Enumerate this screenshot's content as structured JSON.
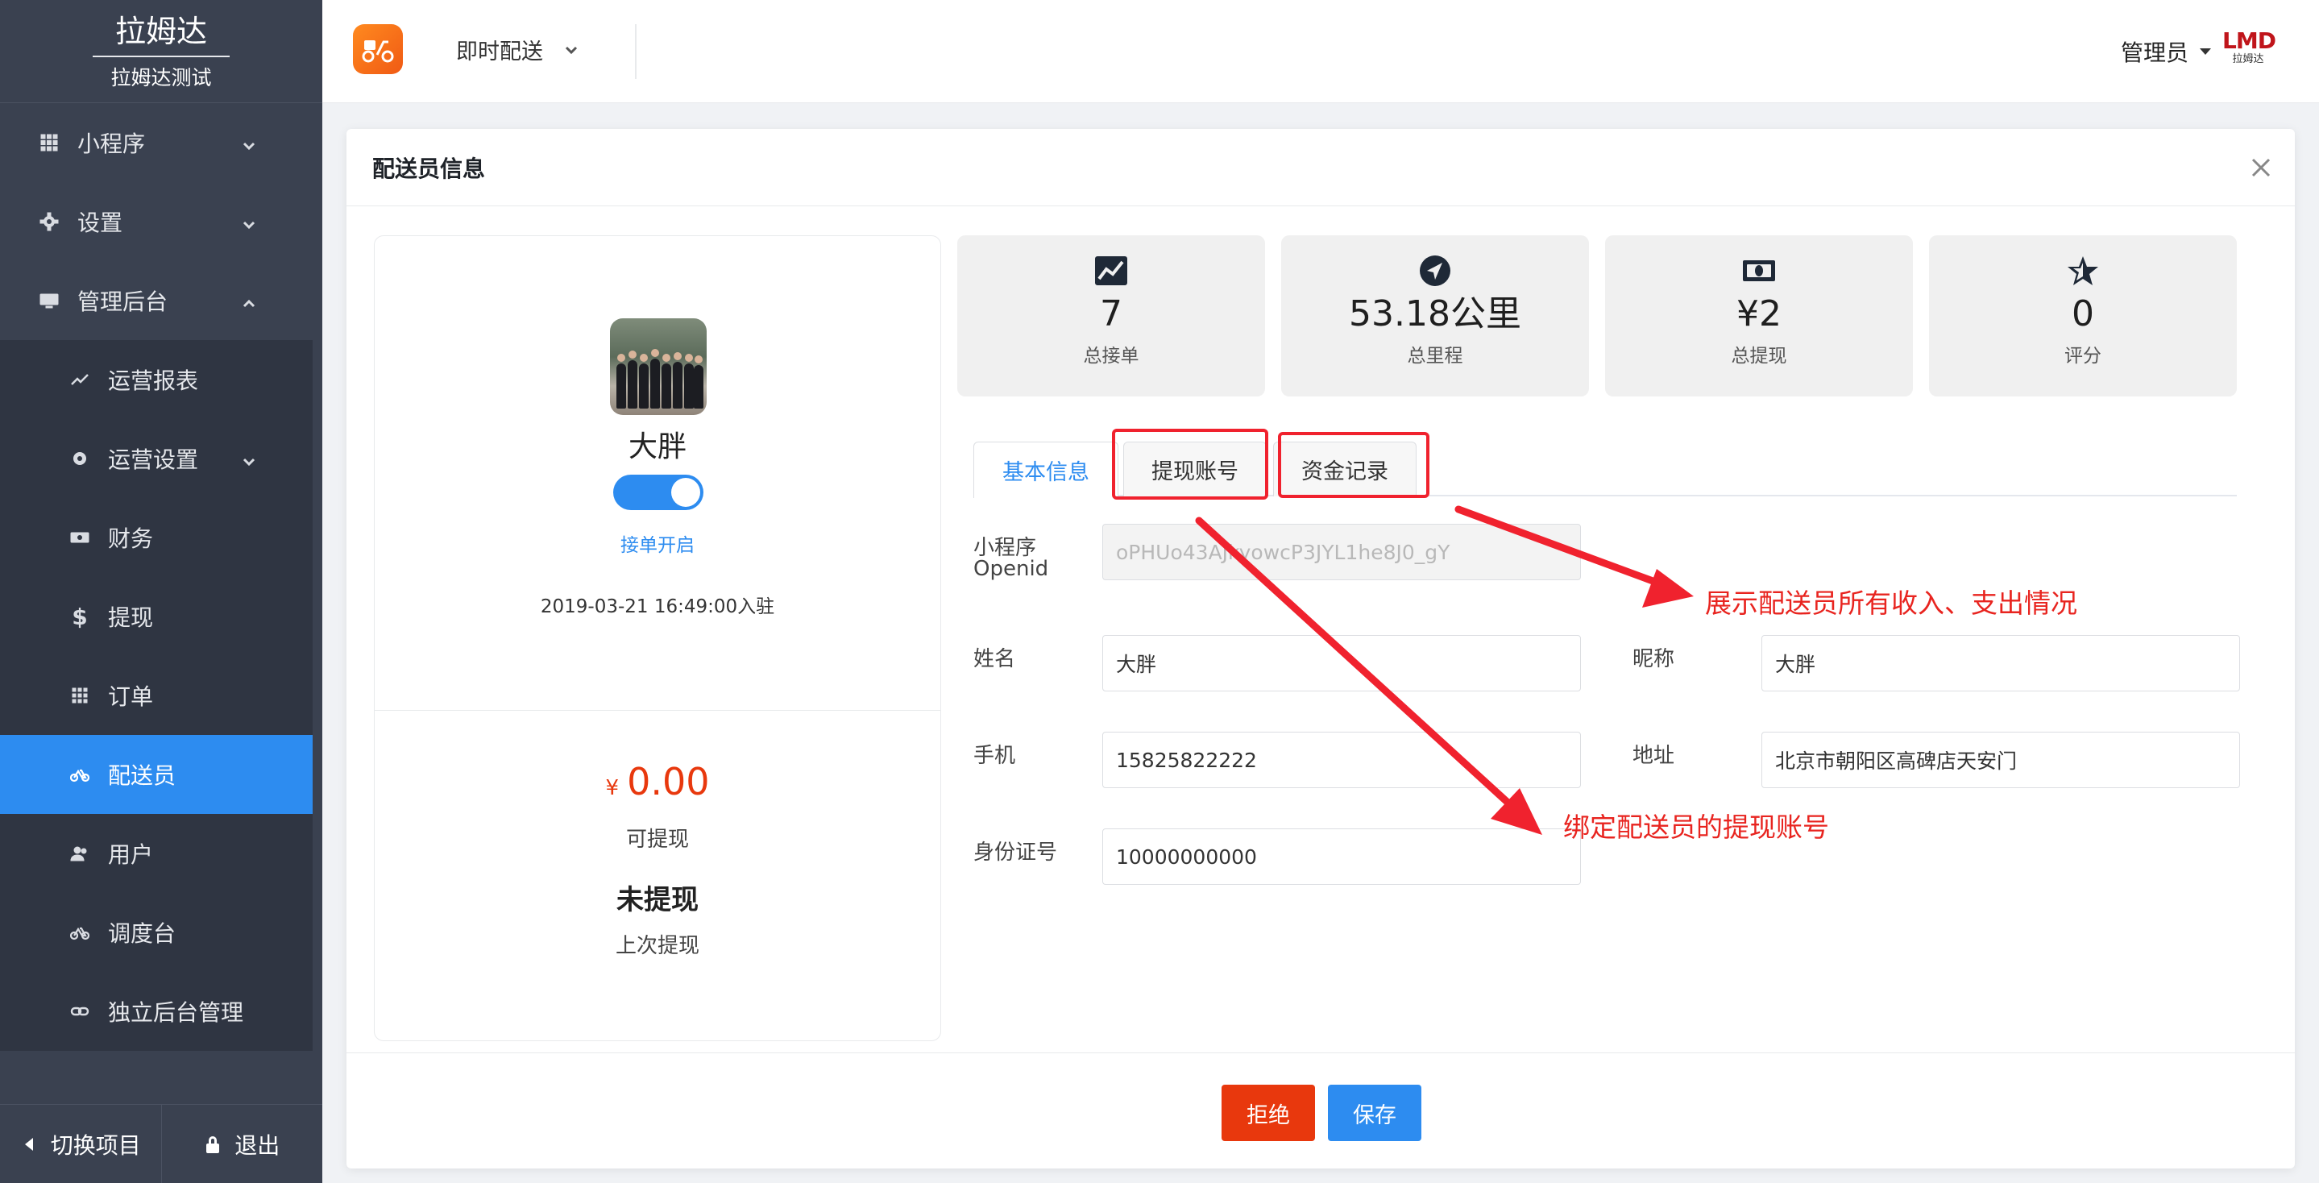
{
  "brand": {
    "title": "拉姆达",
    "subtitle": "拉姆达测试"
  },
  "nav": {
    "items": [
      {
        "label": "小程序"
      },
      {
        "label": "设置"
      },
      {
        "label": "管理后台"
      }
    ],
    "sub_items": [
      {
        "label": "运营报表"
      },
      {
        "label": "运营设置"
      },
      {
        "label": "财务"
      },
      {
        "label": "提现"
      },
      {
        "label": "订单"
      },
      {
        "label": "配送员"
      },
      {
        "label": "用户"
      },
      {
        "label": "调度台"
      },
      {
        "label": "独立后台管理"
      }
    ],
    "active": "配送员"
  },
  "sidebar_footer": {
    "switch_label": "切换项目",
    "logout_label": "退出"
  },
  "header": {
    "app_name": "即时配送",
    "user_label": "管理员",
    "logo_text": "LMD",
    "logo_sub": "拉姆达"
  },
  "modal": {
    "title": "配送员信息",
    "profile": {
      "name": "大胖",
      "toggle_label": "接单开启",
      "join_date": "2019-03-21 16:49:00入驻",
      "currency": "¥",
      "balance": "0.00",
      "balance_label": "可提现",
      "withdraw_status": "未提现",
      "withdraw_label": "上次提现"
    },
    "stats": [
      {
        "value": "7",
        "label": "总接单",
        "icon": "chart-line-icon"
      },
      {
        "value": "53.18公里",
        "label": "总里程",
        "icon": "location-arrow-icon"
      },
      {
        "value": "¥2",
        "label": "总提现",
        "icon": "money-bill-icon"
      },
      {
        "value": "0",
        "label": "评分",
        "icon": "star-icon"
      }
    ],
    "tabs": [
      {
        "label": "基本信息"
      },
      {
        "label": "提现账号"
      },
      {
        "label": "资金记录"
      }
    ],
    "form": {
      "openid_label_1": "小程序",
      "openid_label_2": "Openid",
      "openid_value": "oPHUo43AJkyowcP3JYL1he8J0_gY",
      "name_label": "姓名",
      "name_value": "大胖",
      "nickname_label": "昵称",
      "nickname_value": "大胖",
      "phone_label": "手机",
      "phone_value": "15825822222",
      "address_label": "地址",
      "address_value": "北京市朝阳区高碑店天安门",
      "id_label": "身份证号",
      "id_value": "10000000000"
    },
    "annotations": {
      "records_note": "展示配送员所有收入、支出情况",
      "account_note": "绑定配送员的提现账号"
    },
    "buttons": {
      "reject": "拒绝",
      "save": "保存"
    }
  },
  "colors": {
    "accent": "#2d8cf0",
    "danger": "#e8380d",
    "sidebar": "#3a4150",
    "annotation": "#e8241f"
  }
}
